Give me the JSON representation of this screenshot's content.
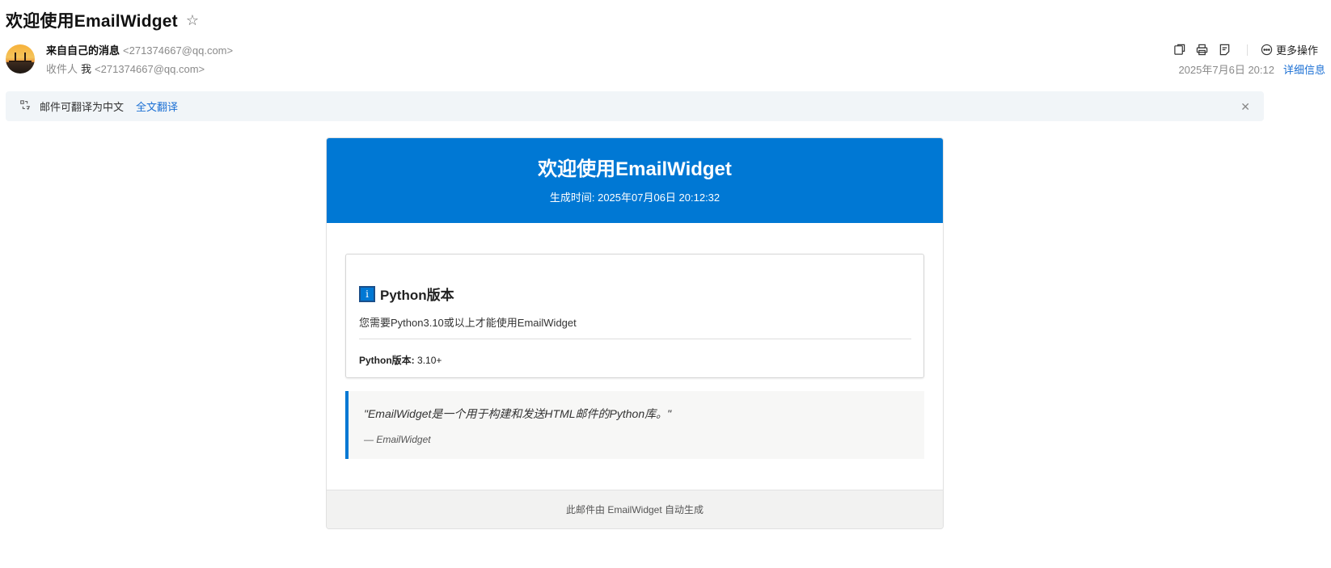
{
  "subject": "欢迎使用EmailWidget",
  "sender": {
    "name": "来自自己的消息",
    "address": "<271374667@qq.com>"
  },
  "recipient": {
    "label": "收件人",
    "name": "我",
    "address": "<271374667@qq.com>"
  },
  "toolbar": {
    "more_label": "更多操作"
  },
  "meta": {
    "date": "2025年7月6日 20:12",
    "details_label": "详细信息"
  },
  "translate_bar": {
    "text": "邮件可翻译为中文",
    "link": "全文翻译"
  },
  "email": {
    "title": "欢迎使用EmailWidget",
    "generated_time": "生成时间: 2025年07月06日 20:12:32",
    "card": {
      "title": "Python版本",
      "description": "您需要Python3.10或以上才能使用EmailWidget",
      "meta_key": "Python版本:",
      "meta_value": "3.10+"
    },
    "quote": {
      "text": "\"EmailWidget是一个用于构建和发送HTML邮件的Python库。\"",
      "cite": "— EmailWidget"
    },
    "footer": "此邮件由 EmailWidget 自动生成"
  },
  "colors": {
    "accent": "#0078d4",
    "link": "#1a6fd4"
  }
}
